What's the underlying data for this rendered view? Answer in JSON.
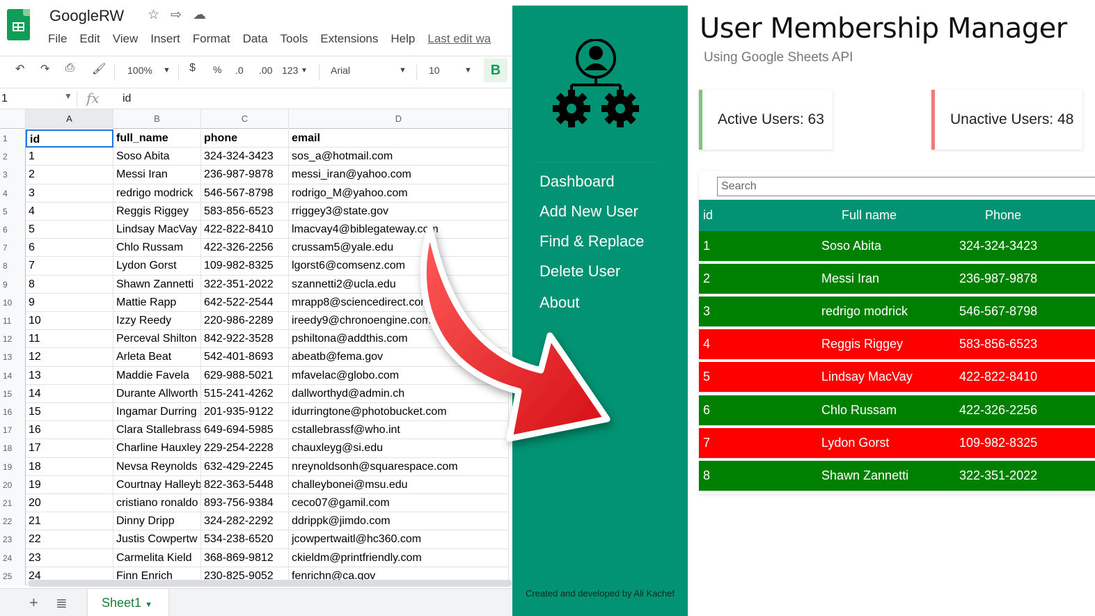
{
  "sheets": {
    "doc_title": "GoogleRW",
    "menu": [
      "File",
      "Edit",
      "View",
      "Insert",
      "Format",
      "Data",
      "Tools",
      "Extensions",
      "Help"
    ],
    "last_edit": "Last edit wa",
    "toolbar": {
      "zoom": "100%",
      "currency": "$",
      "percent": "%",
      "dec_less": ".0",
      "dec_more": ".00",
      "format": "123",
      "font": "Arial",
      "font_size": "10",
      "bold": "B"
    },
    "cell_ref": "1",
    "fx": "fx",
    "formula_value": "id",
    "columns": [
      "A",
      "B",
      "C",
      "D"
    ],
    "rows": [
      {
        "n": "1",
        "cells": [
          "id",
          "full_name",
          "phone",
          "email"
        ]
      },
      {
        "n": "2",
        "cells": [
          "1",
          "Soso Abita",
          "324-324-3423",
          "sos_a@hotmail.com"
        ]
      },
      {
        "n": "3",
        "cells": [
          "2",
          "Messi Iran",
          "236-987-9878",
          "messi_iran@yahoo.com"
        ]
      },
      {
        "n": "4",
        "cells": [
          "3",
          "redrigo modrick",
          "546-567-8798",
          "rodrigo_M@yahoo.com"
        ]
      },
      {
        "n": "5",
        "cells": [
          "4",
          "Reggis Riggey",
          "583-856-6523",
          "rriggey3@state.gov"
        ]
      },
      {
        "n": "6",
        "cells": [
          "5",
          "Lindsay MacVay",
          "422-822-8410",
          "lmacvay4@biblegateway.com"
        ]
      },
      {
        "n": "7",
        "cells": [
          "6",
          "Chlo Russam",
          "422-326-2256",
          "crussam5@yale.edu"
        ]
      },
      {
        "n": "8",
        "cells": [
          "7",
          "Lydon Gorst",
          "109-982-8325",
          "lgorst6@comsenz.com"
        ]
      },
      {
        "n": "9",
        "cells": [
          "8",
          "Shawn Zannetti",
          "322-351-2022",
          "szannetti2@ucla.edu"
        ]
      },
      {
        "n": "10",
        "cells": [
          "9",
          "Mattie Rapp",
          "642-522-2544",
          "mrapp8@sciencedirect.com"
        ]
      },
      {
        "n": "11",
        "cells": [
          "10",
          "Izzy Reedy",
          "220-986-2289",
          "ireedy9@chronoengine.com"
        ]
      },
      {
        "n": "12",
        "cells": [
          "11",
          "Perceval Shilton",
          "842-922-3528",
          "pshiltona@addthis.com"
        ]
      },
      {
        "n": "13",
        "cells": [
          "12",
          "Arleta Beat",
          "542-401-8693",
          "abeatb@fema.gov"
        ]
      },
      {
        "n": "14",
        "cells": [
          "13",
          "Maddie Favela",
          "629-988-5021",
          "mfavelac@globo.com"
        ]
      },
      {
        "n": "15",
        "cells": [
          "14",
          "Durante Allworth",
          "515-241-4262",
          "dallworthyd@admin.ch"
        ]
      },
      {
        "n": "16",
        "cells": [
          "15",
          "Ingamar Durring",
          "201-935-9122",
          "idurringtone@photobucket.com"
        ]
      },
      {
        "n": "17",
        "cells": [
          "16",
          "Clara Stallebrass",
          "649-694-5985",
          "cstallebrassf@who.int"
        ]
      },
      {
        "n": "18",
        "cells": [
          "17",
          "Charline Hauxley",
          "229-254-2228",
          "chauxleyg@si.edu"
        ]
      },
      {
        "n": "19",
        "cells": [
          "18",
          "Nevsa Reynolds",
          "632-429-2245",
          "nreynoldsonh@squarespace.com"
        ]
      },
      {
        "n": "20",
        "cells": [
          "19",
          "Courtnay Halleyb",
          "822-363-5448",
          "challeybonei@msu.edu"
        ]
      },
      {
        "n": "21",
        "cells": [
          "20",
          "cristiano ronaldo",
          "893-756-9384",
          "ceco07@gamil.com"
        ]
      },
      {
        "n": "22",
        "cells": [
          "21",
          "Dinny Dripp",
          "324-282-2292",
          "ddrippk@jimdo.com"
        ]
      },
      {
        "n": "23",
        "cells": [
          "22",
          "Justis Cowpertw",
          "534-238-6520",
          "jcowpertwaitl@hc360.com"
        ]
      },
      {
        "n": "24",
        "cells": [
          "23",
          "Carmelita Kield",
          "368-869-9812",
          "ckieldm@printfriendly.com"
        ]
      },
      {
        "n": "25",
        "cells": [
          "24",
          "Finn Enrich",
          "230-825-9052",
          "fenrichn@ca.gov"
        ]
      }
    ],
    "sheet_tab": "Sheet1"
  },
  "app": {
    "nav": [
      "Dashboard",
      "Add New User",
      "Find & Replace",
      "Delete User",
      "About"
    ],
    "footer": "Created and developed by Ali Kachef",
    "title": "User Membership Manager",
    "subtitle": "Using Google Sheets API",
    "active_users": "Active Users: 63",
    "inactive_users": "Unactive Users: 48",
    "search_placeholder": "Search",
    "table_headers": [
      "id",
      "Full name",
      "Phone"
    ],
    "table_rows": [
      {
        "id": "1",
        "name": "Soso Abita",
        "phone": "324-324-3423",
        "status": "active"
      },
      {
        "id": "2",
        "name": "Messi Iran",
        "phone": "236-987-9878",
        "status": "active"
      },
      {
        "id": "3",
        "name": "redrigo modrick",
        "phone": "546-567-8798",
        "status": "active"
      },
      {
        "id": "4",
        "name": "Reggis Riggey",
        "phone": "583-856-6523",
        "status": "inactive"
      },
      {
        "id": "5",
        "name": "Lindsay MacVay",
        "phone": "422-822-8410",
        "status": "inactive"
      },
      {
        "id": "6",
        "name": "Chlo Russam",
        "phone": "422-326-2256",
        "status": "active"
      },
      {
        "id": "7",
        "name": "Lydon Gorst",
        "phone": "109-982-8325",
        "status": "inactive"
      },
      {
        "id": "8",
        "name": "Shawn Zannetti",
        "phone": "322-351-2022",
        "status": "active"
      }
    ]
  },
  "colors": {
    "sidebar": "#019373",
    "active_row": "#008000",
    "inactive_row": "#ff0000",
    "arrow": "#e8151b"
  }
}
